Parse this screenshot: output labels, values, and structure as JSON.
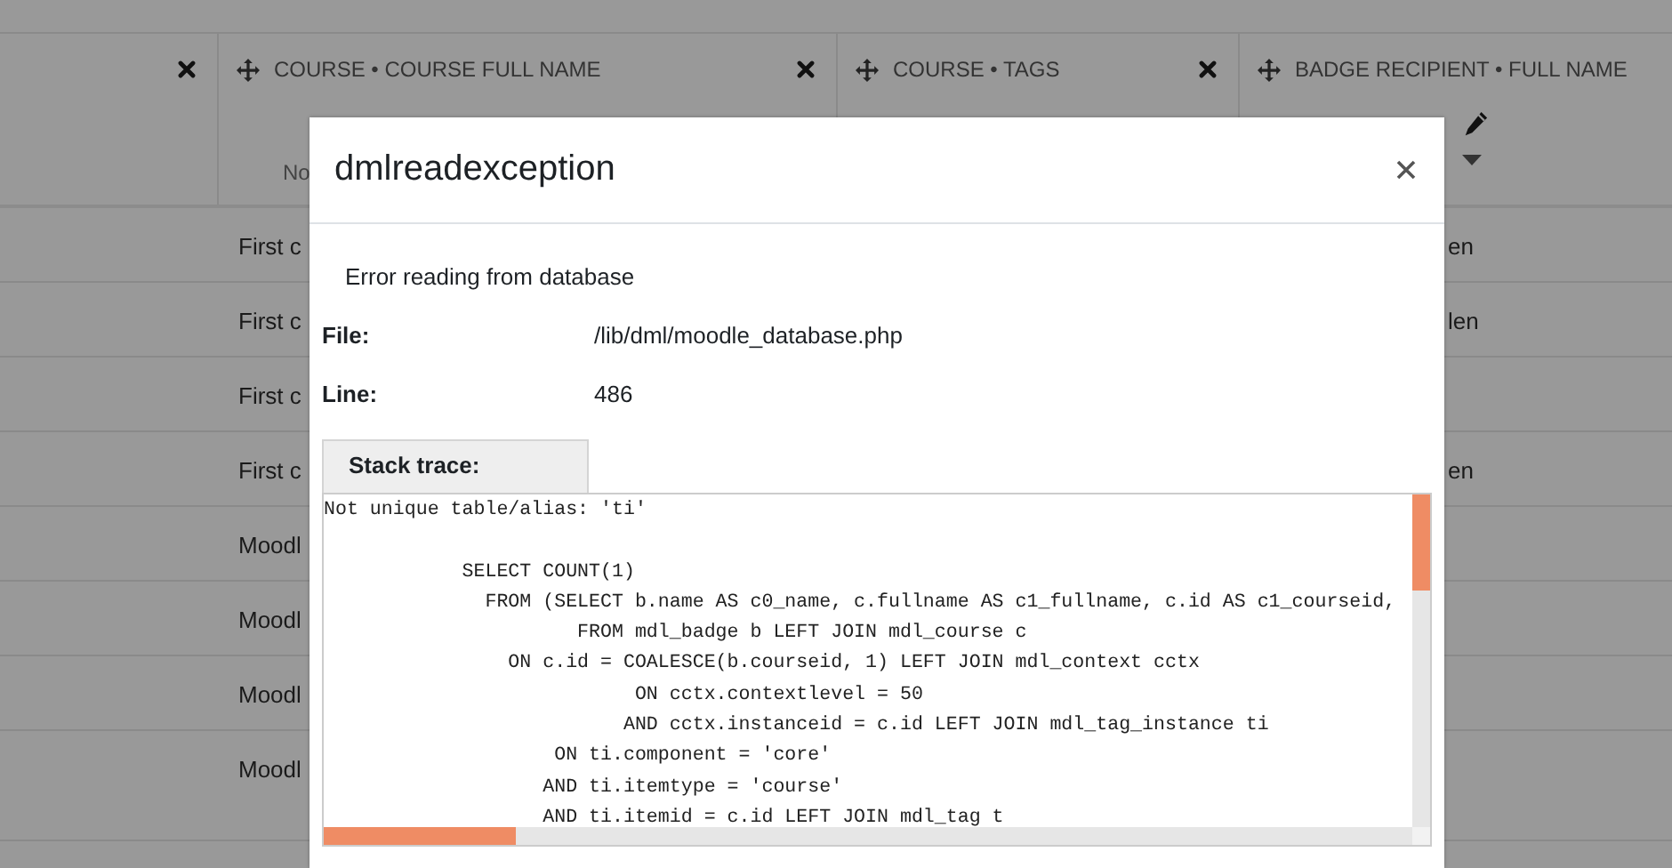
{
  "table": {
    "columns": [
      {
        "move_handle": false,
        "remove_button": true,
        "edit_button": false,
        "sort_menu": false
      },
      {
        "heading": "COURSE • COURSE FULL NAME",
        "note": "No",
        "move_handle": true,
        "remove_button": true,
        "edit_button": false,
        "sort_menu": false
      },
      {
        "heading": "COURSE • TAGS",
        "move_handle": true,
        "remove_button": true,
        "edit_button": false,
        "sort_menu": false
      },
      {
        "heading": "BADGE RECIPIENT • FULL NAME",
        "move_handle": true,
        "remove_button": false,
        "edit_button": true,
        "sort_menu": true
      }
    ],
    "rows": [
      {
        "course": "First c",
        "recipient": "en"
      },
      {
        "course": "First c",
        "recipient": "len"
      },
      {
        "course": "First c",
        "recipient": ""
      },
      {
        "course": "First c",
        "recipient": "en"
      },
      {
        "course": "Moodl",
        "recipient": ""
      },
      {
        "course": "Moodl",
        "recipient": ""
      },
      {
        "course": "Moodl",
        "recipient": ""
      },
      {
        "course": "Moodl",
        "recipient": ""
      }
    ]
  },
  "dialog": {
    "title": "dmlreadexception",
    "message": "Error reading from database",
    "details": [
      {
        "label": "File:",
        "value": "/lib/dml/moodle_database.php"
      },
      {
        "label": "Line:",
        "value": "486"
      }
    ],
    "stack_trace_label": "Stack trace:",
    "stack_trace": "Not unique table/alias: 'ti'\n\n            SELECT COUNT(1)\n              FROM (SELECT b.name AS c0_name, c.fullname AS c1_fullname, c.id AS c1_courseid,\n                      FROM mdl_badge b LEFT JOIN mdl_course c\n                ON c.id = COALESCE(b.courseid, 1) LEFT JOIN mdl_context cctx\n                           ON cctx.contextlevel = 50\n                          AND cctx.instanceid = c.id LEFT JOIN mdl_tag_instance ti\n                    ON ti.component = 'core'\n                   AND ti.itemtype = 'course'\n                   AND ti.itemid = c.id LEFT JOIN mdl_tag t"
  }
}
